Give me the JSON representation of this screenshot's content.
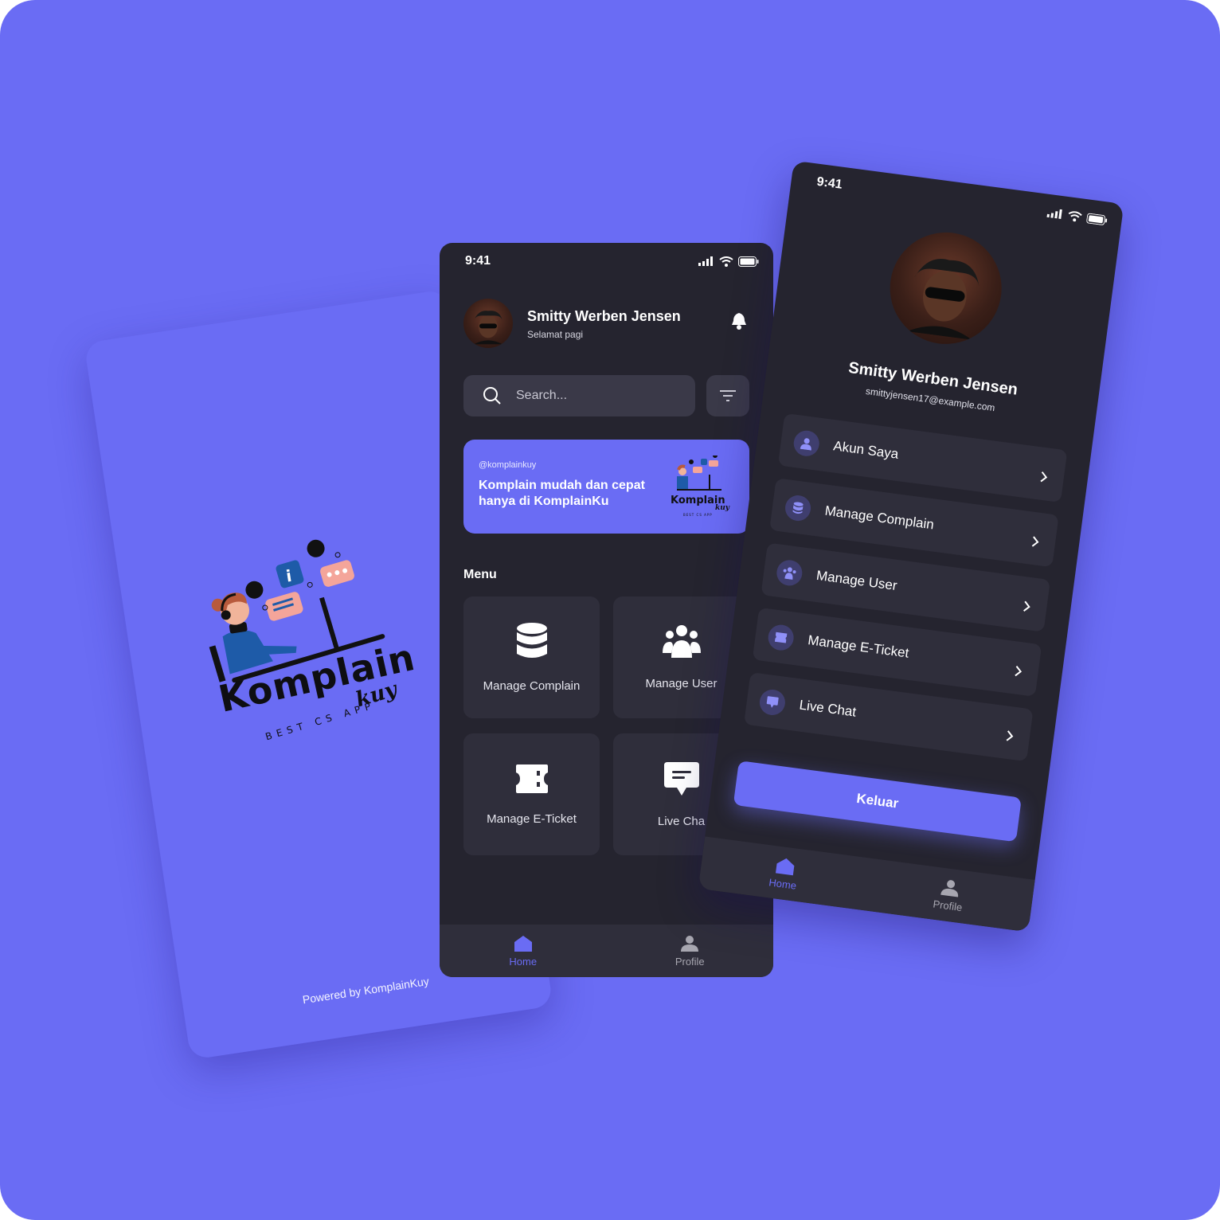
{
  "colors": {
    "background": "#6a6cf4",
    "accent": "#6a6cf4",
    "phone_bg": "#25242f",
    "card_bg": "#2f2e3b",
    "text": "#ffffff",
    "tab_inactive": "#a7a6b0"
  },
  "splash": {
    "logo_word": "Komplain",
    "logo_sub": "kuy",
    "logo_tagline": "BEST CS APP",
    "powered_by": "Powered by KomplainKuy"
  },
  "home": {
    "status_time": "9:41",
    "user_name": "Smitty Werben Jensen",
    "greeting": "Selamat pagi",
    "search_placeholder": "Search...",
    "banner": {
      "handle": "@komplainkuy",
      "line1": "Komplain mudah dan cepat",
      "line2": "hanya di KomplainKu",
      "mini_logo_word": "Komplain",
      "mini_logo_sub": "kuy",
      "mini_logo_tagline": "BEST CS APP"
    },
    "menu_title": "Menu",
    "menu_items": [
      {
        "label": "Manage Complain",
        "icon": "database-icon"
      },
      {
        "label": "Manage User",
        "icon": "users-group-icon"
      },
      {
        "label": "Manage E-Ticket",
        "icon": "ticket-icon"
      },
      {
        "label": "Live Cha",
        "icon": "chat-bubble-icon"
      }
    ],
    "tabs": [
      {
        "label": "Home",
        "icon": "home-icon",
        "active": true
      },
      {
        "label": "Profile",
        "icon": "person-icon",
        "active": false
      }
    ]
  },
  "profile": {
    "status_time": "9:41",
    "name": "Smitty Werben Jensen",
    "email": "smittyjensen17@example.com",
    "items": [
      {
        "label": "Akun Saya",
        "icon": "user-icon"
      },
      {
        "label": "Manage Complain",
        "icon": "database-icon"
      },
      {
        "label": "Manage User",
        "icon": "users-group-icon"
      },
      {
        "label": "Manage E-Ticket",
        "icon": "ticket-icon"
      },
      {
        "label": "Live Chat",
        "icon": "chat-bubble-icon"
      }
    ],
    "logout_label": "Keluar",
    "tabs": [
      {
        "label": "Home",
        "icon": "home-icon",
        "active": true
      },
      {
        "label": "Profile",
        "icon": "person-icon",
        "active": false
      }
    ]
  }
}
